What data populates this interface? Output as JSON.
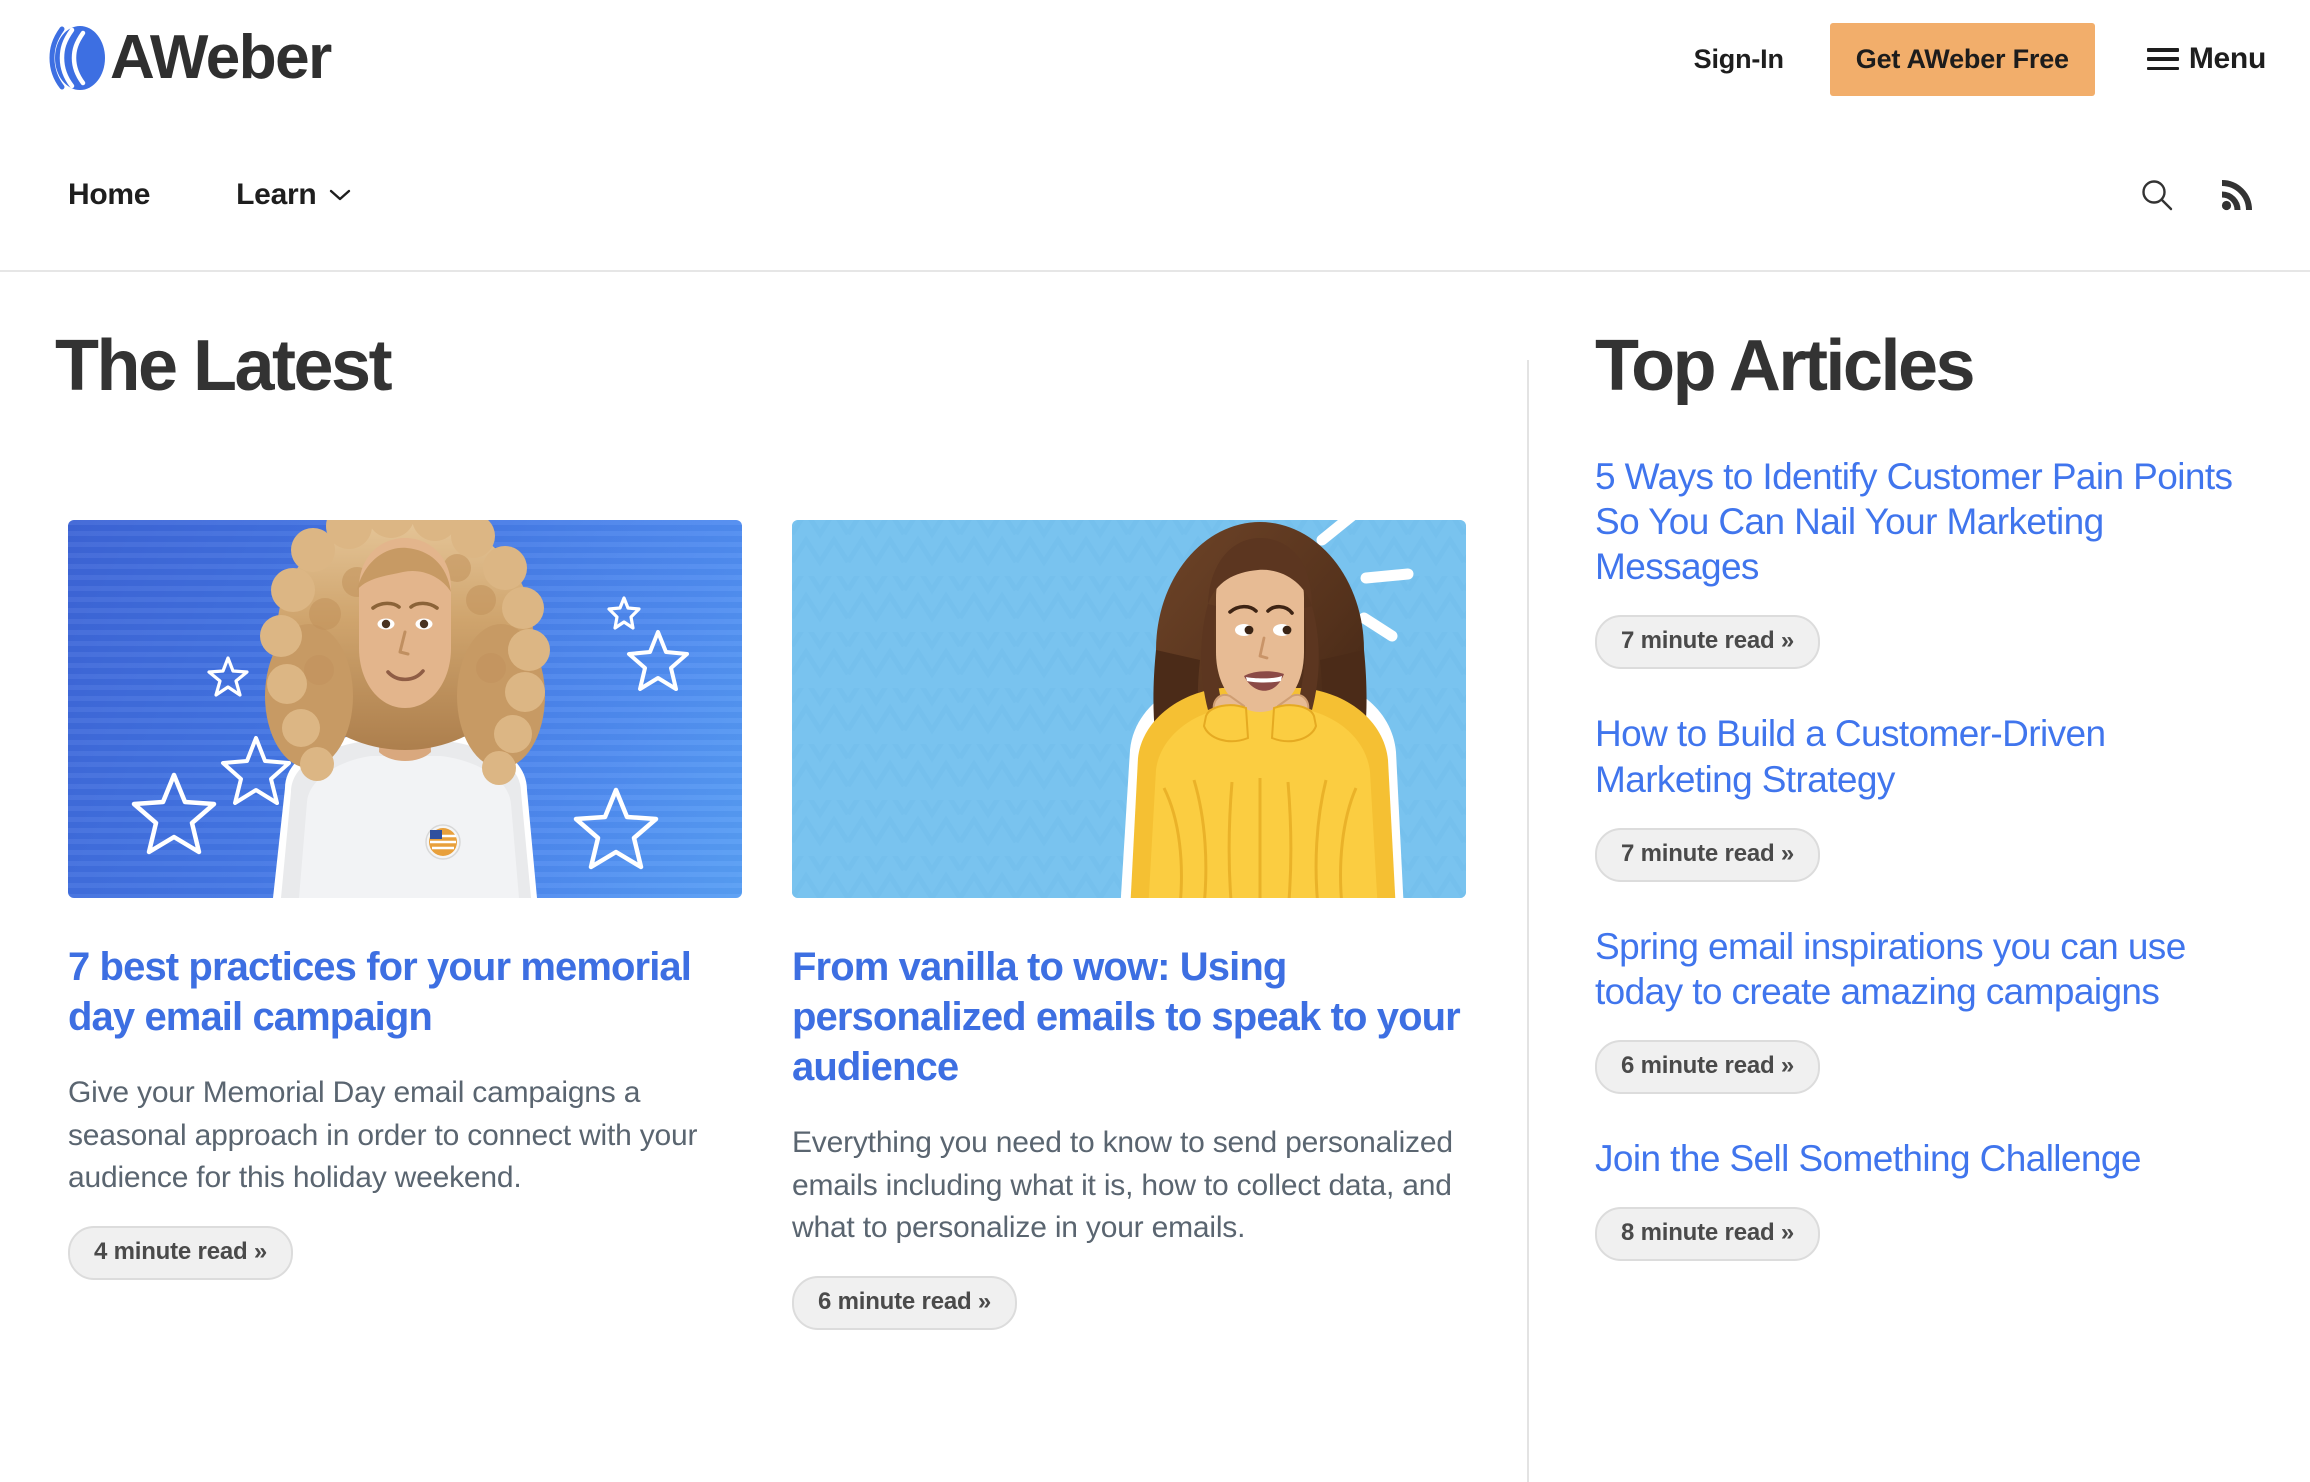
{
  "brand": {
    "name": "AWeber",
    "logo_icon": "aweber-logo-mark",
    "logo_color": "#3d6fe2"
  },
  "topbar": {
    "signin_label": "Sign-In",
    "cta_label": "Get AWeber Free",
    "cta_color": "#f2ae6b",
    "menu_label": "Menu",
    "menu_icon": "hamburger-icon"
  },
  "nav": {
    "items": [
      {
        "label": "Home",
        "has_caret": false
      },
      {
        "label": "Learn",
        "has_caret": true
      }
    ],
    "search_icon": "search-icon",
    "rss_icon": "rss-icon"
  },
  "main": {
    "heading": "The Latest",
    "articles": [
      {
        "title": "7 best practices for your memorial day email campaign",
        "excerpt": "Give your Memorial Day email campaigns a seasonal approach in order to connect with your audience for this holiday weekend.",
        "read_time": "4 minute read »",
        "image_alt": "Woman with curly blonde hair in a white sweatshirt on a blue striped background with white stars"
      },
      {
        "title": "From vanilla to wow: Using personalized emails to speak to your audience",
        "excerpt": "Everything you need to know to send personalized emails including what it is, how to collect data, and what to personalize in your emails.",
        "read_time": "6 minute read »",
        "image_alt": "Excited woman in a yellow sweater on a light blue zigzag background"
      }
    ]
  },
  "sidebar": {
    "heading": "Top Articles",
    "items": [
      {
        "title": "5 Ways to Identify Customer Pain Points So You Can Nail Your Marketing Messages",
        "read_time": "7 minute read »"
      },
      {
        "title": "How to Build a Customer-Driven Marketing Strategy",
        "read_time": "7 minute read »"
      },
      {
        "title": "Spring email inspirations you can use today to create amazing campaigns",
        "read_time": "6 minute read »"
      },
      {
        "title": "Join the Sell Something Challenge",
        "read_time": "8 minute read »"
      }
    ]
  },
  "colors": {
    "link_blue": "#4075ed",
    "card_title_blue": "#3d6fe2",
    "heading_dark": "#333333",
    "pill_bg": "#f0f0f0",
    "pill_border": "#dcdcdc",
    "accent_orange": "#f2ae6b"
  }
}
